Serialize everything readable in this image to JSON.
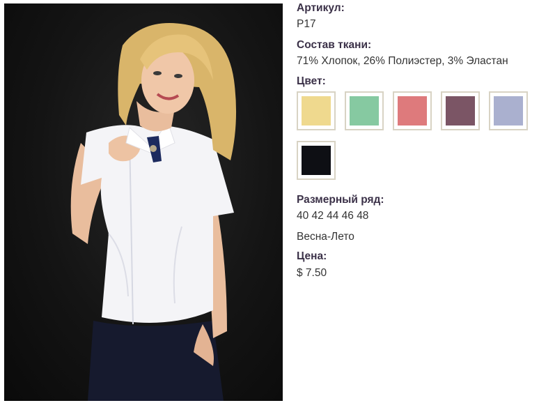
{
  "product": {
    "article_label": "Артикул:",
    "article_value": "P17",
    "fabric_label": "Состав ткани:",
    "fabric_value": "71% Хлопок, 26% Полиэстер, 3% Эластан",
    "color_label": "Цвет:",
    "colors": [
      {
        "name": "yellow",
        "hex": "#efd98e"
      },
      {
        "name": "mint",
        "hex": "#86c9a1"
      },
      {
        "name": "pink",
        "hex": "#de7a7c"
      },
      {
        "name": "mauve",
        "hex": "#7b5565"
      },
      {
        "name": "lavender-gray",
        "hex": "#aab0cf"
      },
      {
        "name": "black",
        "hex": "#0e0f14"
      }
    ],
    "sizes_label": "Размерный ряд:",
    "sizes_value": "40 42 44 46 48",
    "season": "Весна-Лето",
    "price_label": "Цена:",
    "price_value": "$ 7.50"
  }
}
